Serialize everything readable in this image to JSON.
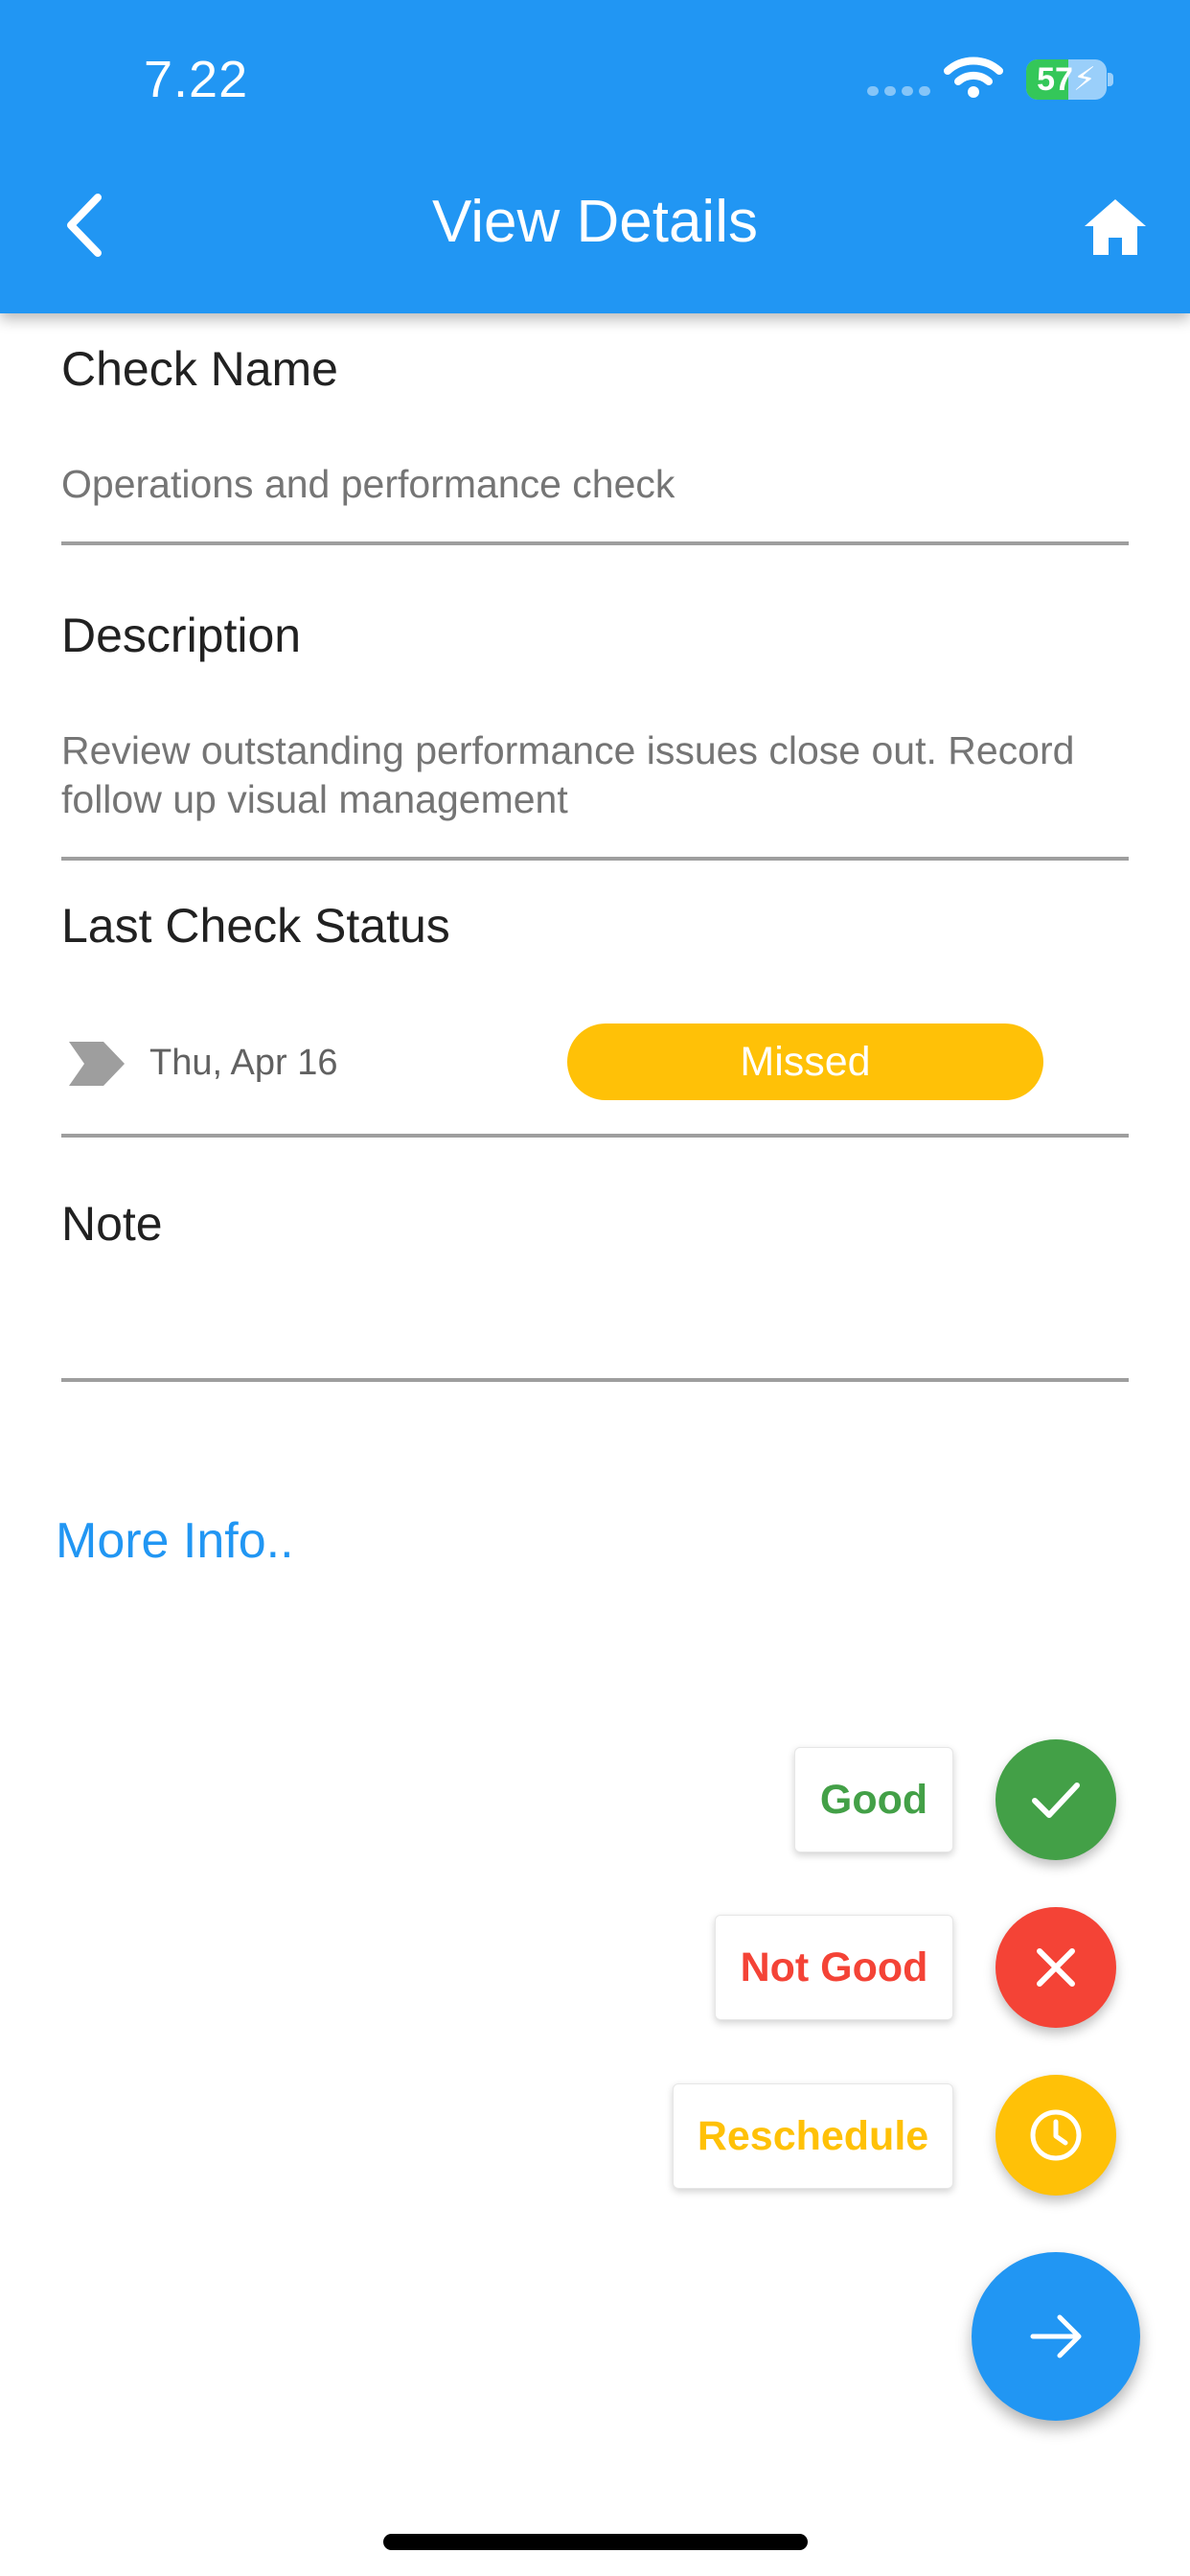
{
  "status_bar": {
    "time": "7.22",
    "battery": "57",
    "icons": [
      "cellular-signal-icon",
      "wifi-icon",
      "battery-charging-icon"
    ]
  },
  "app_bar": {
    "title": "View Details",
    "back_icon": "chevron-left-icon",
    "home_icon": "home-icon",
    "background": "#2196f3"
  },
  "fields": {
    "check_name": {
      "label": "Check Name",
      "value": "Operations and performance check"
    },
    "description": {
      "label": "Description",
      "value_line1": "Review outstanding performance issues close out. Record",
      "value_line2": "follow up visual management"
    },
    "last_check_status": {
      "label": "Last Check Status",
      "date": "Thu, Apr 16",
      "status": "Missed",
      "status_color": "#ffc107"
    },
    "note": {
      "label": "Note",
      "value": ""
    }
  },
  "more_info_link": "More Info..",
  "actions": [
    {
      "label": "Good",
      "icon": "check-icon",
      "color": "#43a047"
    },
    {
      "label": "Not Good",
      "icon": "close-icon",
      "color": "#f44336"
    },
    {
      "label": "Reschedule",
      "icon": "clock-icon",
      "color": "#ffc107"
    }
  ],
  "main_fab": {
    "icon": "arrow-right-icon",
    "color": "#2196f3"
  }
}
